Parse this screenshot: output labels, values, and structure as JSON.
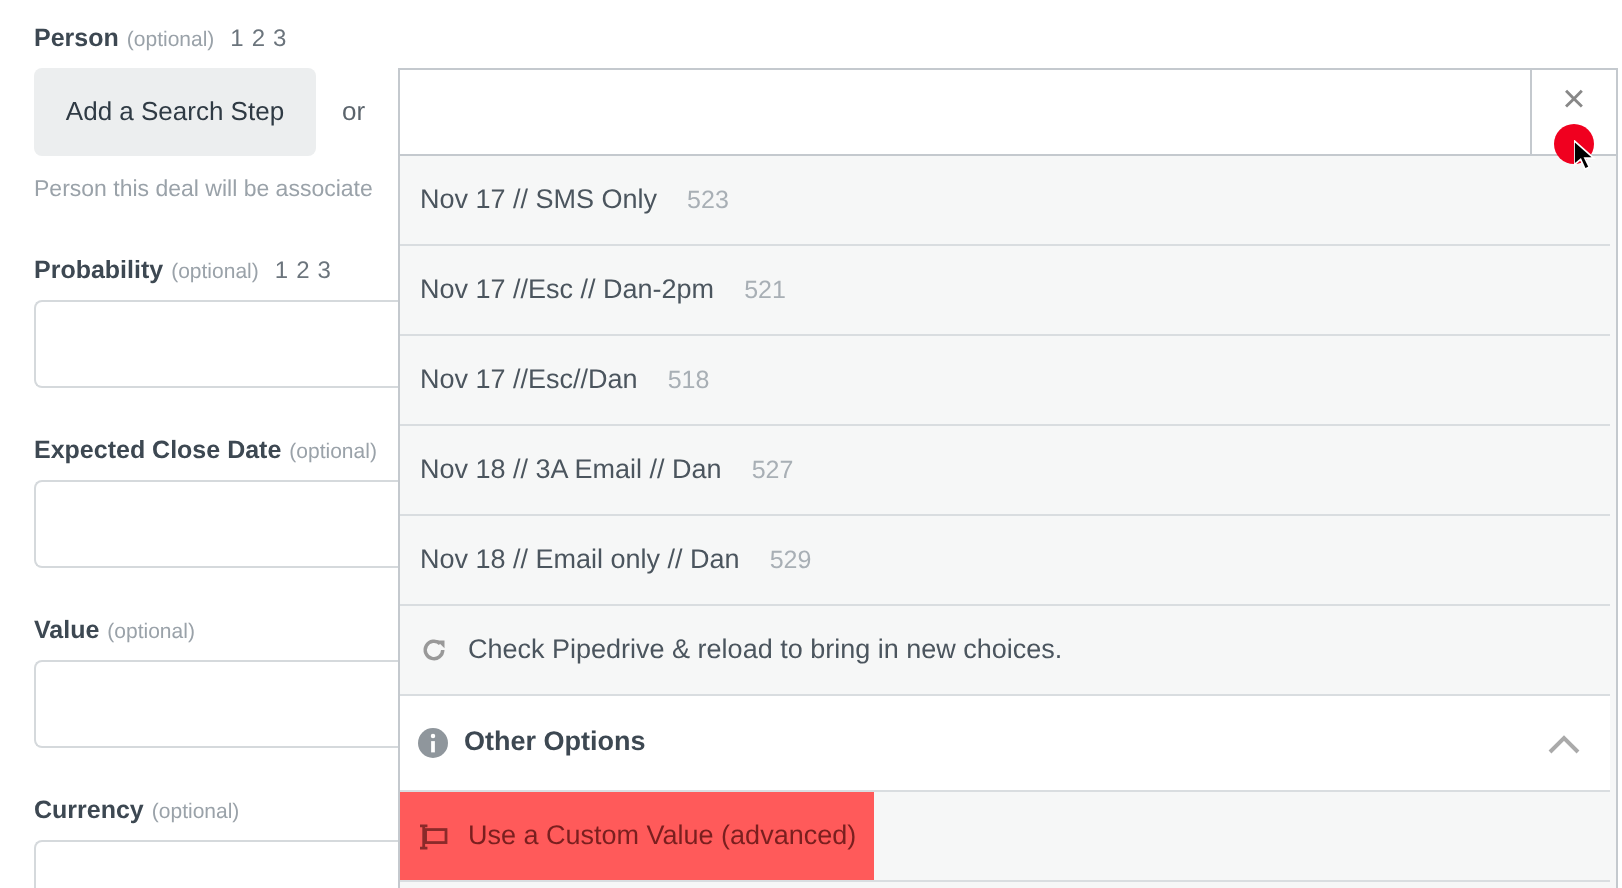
{
  "fields": [
    {
      "label": "Person",
      "hint": "(optional)",
      "tags": [
        "1",
        "2",
        "3"
      ],
      "kind": "search"
    },
    {
      "label": "Probability",
      "hint": "(optional)",
      "tags": [
        "1",
        "2",
        "3"
      ],
      "kind": "text"
    },
    {
      "label": "Expected Close Date",
      "hint": "(optional)",
      "kind": "text"
    },
    {
      "label": "Value",
      "hint": "(optional)",
      "kind": "text"
    },
    {
      "label": "Currency",
      "hint": "(optional)",
      "kind": "text"
    }
  ],
  "search_step_button": "Add a Search Step",
  "or_text": "or",
  "person_help": "Person this deal will be associate",
  "dropdown": {
    "clear": "×",
    "options": [
      {
        "label": "Nov 17 // SMS Only",
        "count": "523"
      },
      {
        "label": "Nov 17 //Esc // Dan-2pm",
        "count": "521"
      },
      {
        "label": "Nov 17 //Esc//Dan",
        "count": "518"
      },
      {
        "label": "Nov 18 // 3A Email // Dan",
        "count": "527"
      },
      {
        "label": "Nov 18 // Email only // Dan",
        "count": "529"
      }
    ],
    "reload": "Check Pipedrive & reload to bring in new choices.",
    "other_options": {
      "title": "Other Options",
      "expanded": true,
      "items": [
        {
          "label": "Use a Custom Value (advanced)",
          "selected": true
        }
      ]
    }
  }
}
